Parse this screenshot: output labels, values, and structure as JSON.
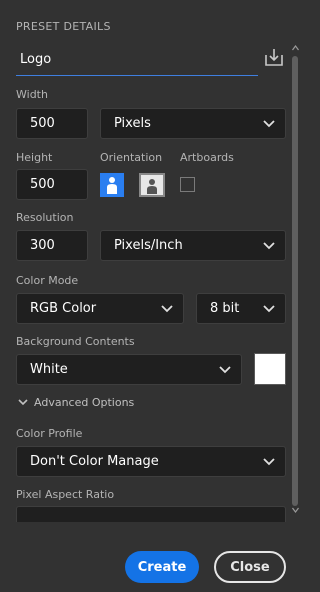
{
  "panel": {
    "title": "PRESET DETAILS"
  },
  "preset_name": {
    "value": "Logo"
  },
  "width": {
    "label": "Width",
    "value": "500",
    "unit": "Pixels"
  },
  "height": {
    "label": "Height",
    "value": "500"
  },
  "orientation": {
    "label": "Orientation",
    "selected": "portrait"
  },
  "artboards": {
    "label": "Artboards",
    "checked": false
  },
  "resolution": {
    "label": "Resolution",
    "value": "300",
    "unit": "Pixels/Inch"
  },
  "color_mode": {
    "label": "Color Mode",
    "mode": "RGB Color",
    "depth": "8 bit"
  },
  "background": {
    "label": "Background Contents",
    "value": "White",
    "swatch_color": "#ffffff"
  },
  "advanced": {
    "label": "Advanced Options"
  },
  "color_profile": {
    "label": "Color Profile",
    "value": "Don't Color Manage"
  },
  "pixel_aspect": {
    "label": "Pixel Aspect Ratio"
  },
  "actions": {
    "create": "Create",
    "close": "Close"
  },
  "colors": {
    "accent": "#1473e6",
    "background": "#323232",
    "field": "#1f1f1f"
  }
}
